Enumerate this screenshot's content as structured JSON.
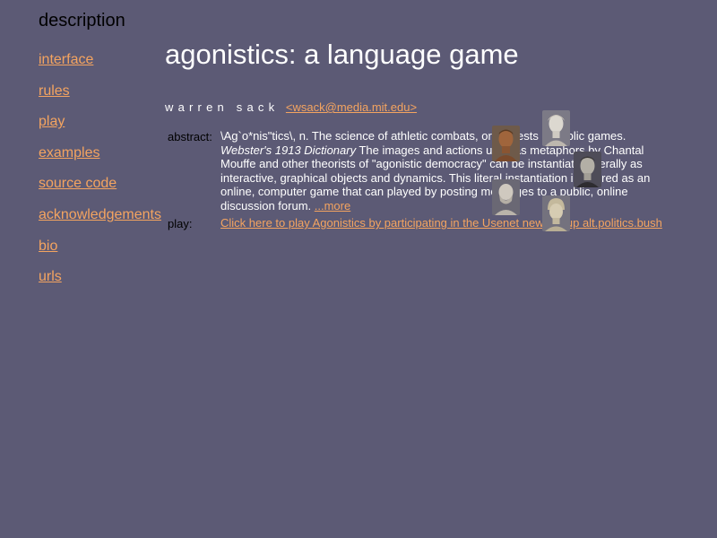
{
  "nav": {
    "heading": "description",
    "items": [
      {
        "label": "interface"
      },
      {
        "label": "rules"
      },
      {
        "label": "play"
      },
      {
        "label": "examples"
      },
      {
        "label": "source code"
      },
      {
        "label": "acknowledgements"
      },
      {
        "label": "bio"
      },
      {
        "label": "urls"
      }
    ]
  },
  "main": {
    "title": "agonistics: a language game",
    "author_name": "warren sack",
    "author_email": "<wsack@media.mit.edu>",
    "abstract_label": "abstract:",
    "abstract_part1": "\\Ag`o*nis\"tics\\, n. The science of athletic combats, or contests in public games. ",
    "abstract_source": "Webster's 1913 Dictionary",
    "abstract_part2": " The images and actions used as metaphors by Chantal Mouffe and other theorists of \"agonistic democracy\" can be instantiated literally as interactive, graphical objects and dynamics. This literal instantiation is offered as an online, computer game that can played by posting messages to a public, online discussion forum. ",
    "more_link": "...more",
    "play_label": "play:",
    "play_link": "Click here to play Agonistics by participating in the Usenet newsgroup alt.politics.bush"
  },
  "colors": {
    "background": "#5c5a75",
    "link": "#f4a460",
    "text": "#ffffff",
    "label": "#000000"
  },
  "busts": [
    {
      "icon": "bronze-bust-icon"
    },
    {
      "icon": "marble-bust-icon"
    },
    {
      "icon": "stone-bust-icon"
    },
    {
      "icon": "bearded-bust-icon"
    },
    {
      "icon": "helmeted-bust-icon"
    }
  ]
}
